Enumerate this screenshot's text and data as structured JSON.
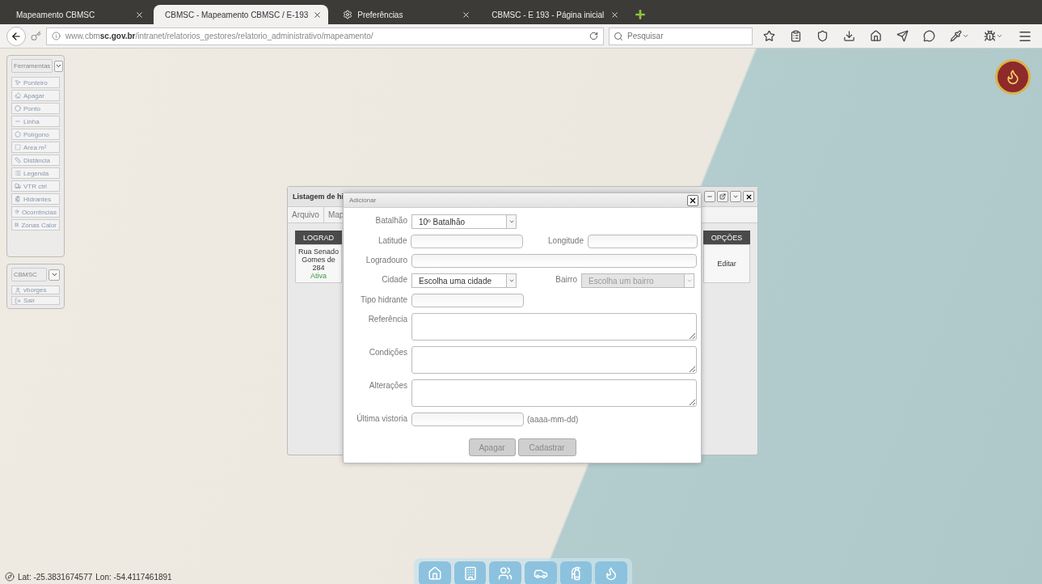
{
  "browser": {
    "tabs": [
      {
        "title": "Mapeamento CBMSC",
        "kind": "page",
        "selected": false
      },
      {
        "title": "CBMSC - Mapeamento CBMSC / E-193",
        "kind": "page",
        "selected": true
      },
      {
        "title": "Preferências",
        "kind": "settings",
        "selected": false
      },
      {
        "title": "CBMSC - E 193 - Página inicial",
        "kind": "page",
        "selected": false
      }
    ],
    "address": "www.cbm**sc.gov.br**/intranet/relatorios_gestores/relatorio_administrativo/mapeamento/",
    "search": {
      "placeholder": "Pesquisar"
    }
  },
  "tools_panel": {
    "title": "Ferramentas",
    "items": [
      {
        "label": "Ponteiro",
        "kind": "pointer"
      },
      {
        "label": "Apagar",
        "kind": "eraser"
      },
      {
        "label": "Ponto",
        "kind": "point"
      },
      {
        "label": "Linha",
        "kind": "line"
      },
      {
        "label": "Polígono",
        "kind": "polygon"
      },
      {
        "label": "Area m²",
        "kind": "area"
      },
      {
        "label": "Distância",
        "kind": "distance"
      },
      {
        "label": "Legenda",
        "kind": "legend"
      },
      {
        "label": "VTR ctrl",
        "kind": "vehicle"
      },
      {
        "label": "Hidrantes",
        "kind": "hydrant"
      },
      {
        "label": "Ocorrências",
        "kind": "incidents"
      },
      {
        "label": "Zonas Calor",
        "kind": "heat"
      }
    ]
  },
  "user_panel": {
    "title": "CBMSC",
    "items": [
      {
        "label": "vborges",
        "kind": "user"
      },
      {
        "label": "Sair",
        "kind": "exit"
      }
    ]
  },
  "listing_window": {
    "title": "Listagem de hi",
    "menu": [
      "Arquivo",
      "Map"
    ],
    "columns": [
      "LOGRAD",
      "OPÇÕES"
    ],
    "row": {
      "lines": [
        "Rua Senado",
        "Gomes de",
        "284"
      ],
      "status": "Ativa",
      "action": "Editar"
    }
  },
  "dialog": {
    "title": "Adicionar",
    "rows": [
      {
        "fields": [
          {
            "label": "Batalhão",
            "kind": "select",
            "value": "10º Batalhão",
            "disabled": false
          }
        ]
      },
      {
        "fields": [
          {
            "label": "Latitude",
            "kind": "text"
          },
          {
            "label": "Longitude",
            "kind": "text"
          }
        ]
      },
      {
        "fields": [
          {
            "label": "Logradouro",
            "kind": "wide"
          }
        ]
      },
      {
        "fields": [
          {
            "label": "Cidade",
            "kind": "select",
            "value": "Escolha uma cidade",
            "disabled": false
          },
          {
            "label": "Bairro",
            "kind": "select",
            "value": "Escolha um bairro",
            "disabled": true
          }
        ]
      },
      {
        "fields": [
          {
            "label": "Tipo hidrante",
            "kind": "text"
          }
        ]
      },
      {
        "fields": [
          {
            "label": "Referência",
            "kind": "textarea"
          }
        ]
      },
      {
        "fields": [
          {
            "label": "Condições",
            "kind": "textarea"
          }
        ]
      },
      {
        "fields": [
          {
            "label": "Alterações",
            "kind": "textarea"
          }
        ]
      },
      {
        "fields": [
          {
            "label": "Última vistoria",
            "kind": "text",
            "hint": "(aaaa-mm-dd)"
          }
        ]
      }
    ],
    "buttons": [
      "Apagar",
      "Cadastrar"
    ]
  },
  "coordinates": {
    "lat": "Lat: -25.3831674577",
    "lon": "Lon: -54.4117461891"
  }
}
